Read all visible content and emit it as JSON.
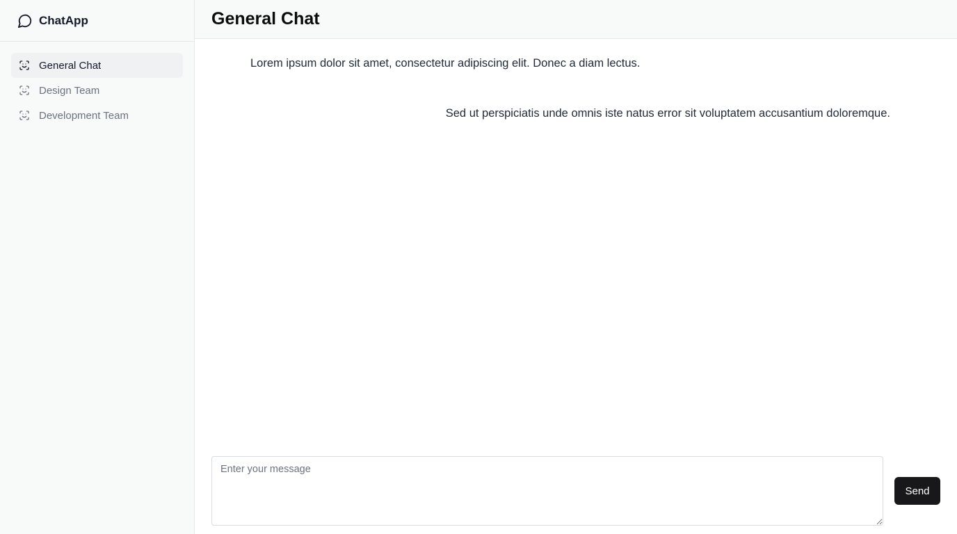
{
  "brand": {
    "name": "ChatApp",
    "icon": "message-circle-icon"
  },
  "sidebar": {
    "items": [
      {
        "label": "General Chat",
        "icon": "scan-face-icon",
        "active": true
      },
      {
        "label": "Design Team",
        "icon": "scan-face-icon",
        "active": false
      },
      {
        "label": "Development Team",
        "icon": "scan-face-icon",
        "active": false
      }
    ]
  },
  "header": {
    "title": "General Chat"
  },
  "messages": [
    {
      "text": "Lorem ipsum dolor sit amet, consectetur adipiscing elit. Donec a diam lectus.",
      "align": "left"
    },
    {
      "text": "Sed ut perspiciatis unde omnis iste natus error sit voluptatem accusantium doloremque.",
      "align": "right"
    }
  ],
  "composer": {
    "placeholder": "Enter your message",
    "value": "",
    "send_label": "Send"
  },
  "colors": {
    "sidebar_bg": "#f8faf9",
    "active_item_bg": "#f0f1f3",
    "send_button_bg": "#18181b"
  }
}
